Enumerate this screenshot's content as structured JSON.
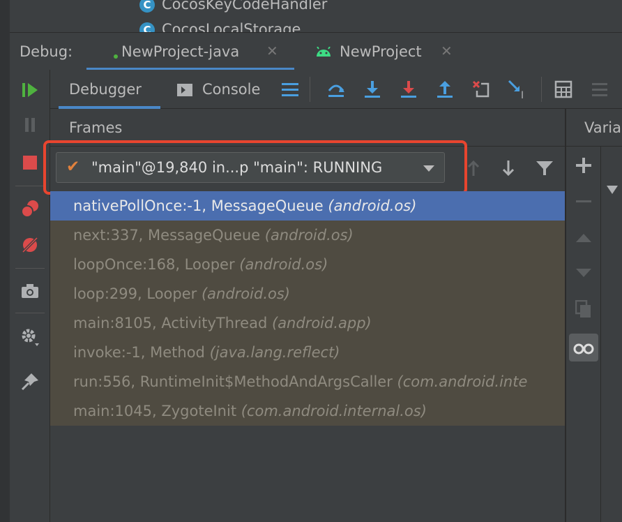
{
  "project_tree": {
    "items": [
      {
        "icon": "class-icon",
        "label": "CocosKeyCodeHandler"
      },
      {
        "icon": "class-icon",
        "label": "CocosLocalStorage"
      }
    ]
  },
  "debug_bar": {
    "label": "Debug:",
    "tabs": [
      {
        "label": "NewProject-java",
        "icon": "java-run-dot-icon",
        "active": true
      },
      {
        "label": "NewProject",
        "icon": "android-icon",
        "active": false
      }
    ]
  },
  "toolbar": {
    "tabs": [
      {
        "label": "Debugger",
        "active": true
      },
      {
        "label": "Console",
        "active": false
      }
    ],
    "icons": [
      "layout-icon",
      "show-execution-point-icon",
      "step-over-icon",
      "step-into-icon",
      "force-step-into-icon",
      "step-out-icon",
      "drop-frame-icon",
      "run-to-cursor-icon",
      "evaluate-expression-icon",
      "trace-icon"
    ]
  },
  "left_toolbar": {
    "icons": [
      "resume-icon",
      "pause-icon",
      "stop-icon",
      "view-breakpoints-icon",
      "mute-breakpoints-icon",
      "camera-icon",
      "settings-icon",
      "pin-icon"
    ]
  },
  "frames": {
    "title": "Frames",
    "thread_selector": "\"main\"@19,840 in...p \"main\": RUNNING",
    "rows": [
      {
        "method": "nativePollOnce:-1, MessageQueue",
        "package": "(android.os)",
        "selected": true
      },
      {
        "method": "next:337, MessageQueue",
        "package": "(android.os)",
        "selected": false
      },
      {
        "method": "loopOnce:168, Looper",
        "package": "(android.os)",
        "selected": false
      },
      {
        "method": "loop:299, Looper",
        "package": "(android.os)",
        "selected": false
      },
      {
        "method": "main:8105, ActivityThread",
        "package": "(android.app)",
        "selected": false
      },
      {
        "method": "invoke:-1, Method",
        "package": "(java.lang.reflect)",
        "selected": false
      },
      {
        "method": "run:556, RuntimeInit$MethodAndArgsCaller",
        "package": "(com.android.inte",
        "selected": false
      },
      {
        "method": "main:1045, ZygoteInit",
        "package": "(com.android.internal.os)",
        "selected": false
      }
    ]
  },
  "variables": {
    "title": "Varia"
  },
  "colors": {
    "accent": "#4a88c7",
    "selection": "#4b6eaf",
    "highlight": "#e8452f",
    "check": "#e0813d",
    "resume_green": "#4fb23f",
    "stop_red": "#db4b4b"
  }
}
